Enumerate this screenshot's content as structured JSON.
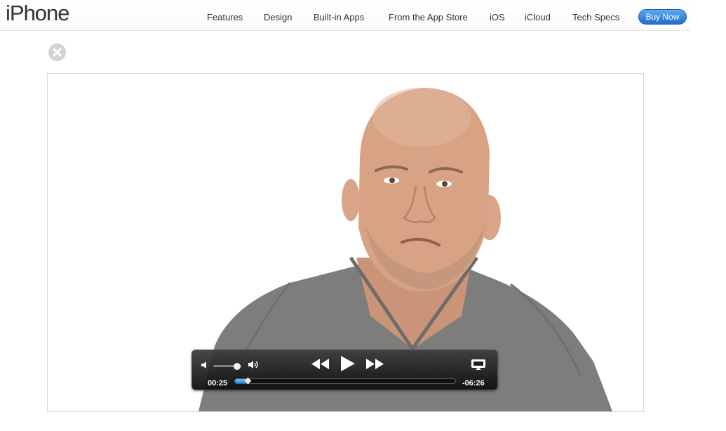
{
  "header": {
    "logo": "iPhone",
    "nav": [
      "Features",
      "Design",
      "Built-in Apps",
      "From the App Store",
      "iOS",
      "iCloud",
      "Tech Specs"
    ],
    "buy_label": "Buy Now",
    "accent_color": "#2a7ad8"
  },
  "player": {
    "current_time": "00:25",
    "remaining_time": "-06:26",
    "progress_fraction": 0.06,
    "volume_fraction": 0.85
  },
  "icons": [
    "close-icon",
    "volume-low-icon",
    "volume-high-icon",
    "rewind-icon",
    "play-icon",
    "fast-forward-icon",
    "airplay-icon"
  ]
}
